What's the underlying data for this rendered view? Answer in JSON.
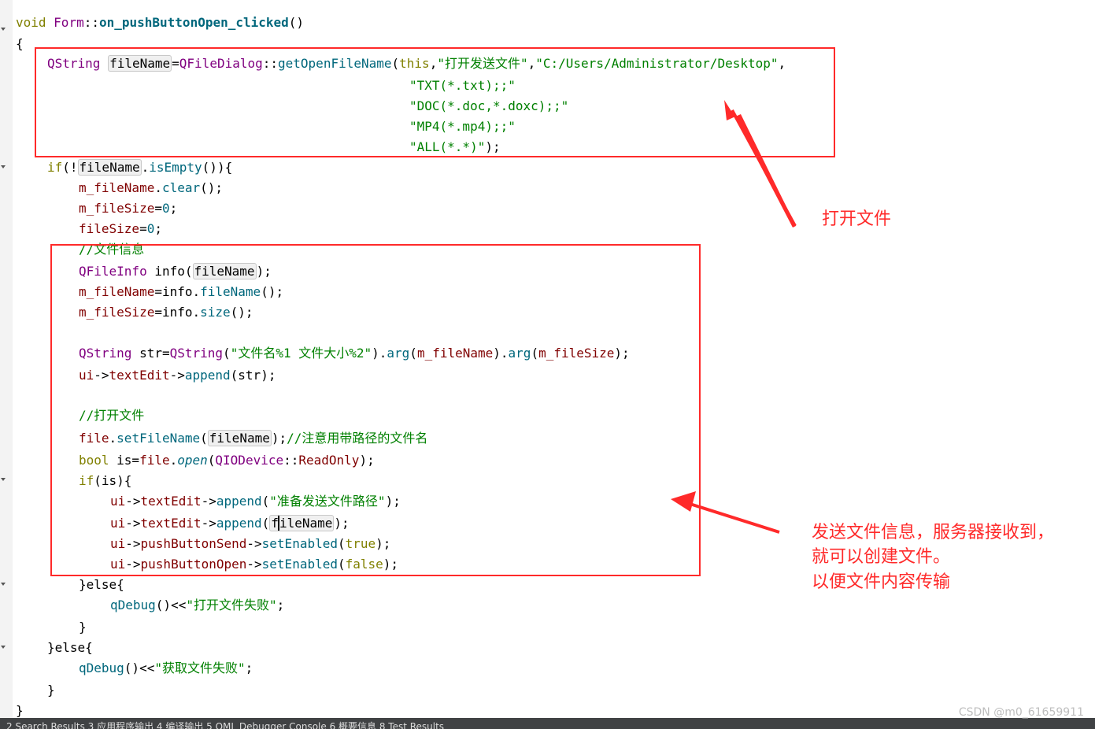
{
  "editor": {
    "language": "C++",
    "code": {
      "l1": {
        "a": "void",
        "b": "Form",
        "c": "::",
        "d": "on_pushButtonOpen_clicked",
        "e": "()"
      },
      "l2": {
        "a": "{"
      },
      "l3": {
        "a": "QString",
        "b": "fileName",
        "c": "=",
        "d": "QFileDialog",
        "e": "::",
        "f": "getOpenFileName",
        "g": "(",
        "h": "this",
        "i": ",",
        "j": "\"打开发送文件\"",
        "k": ",",
        "l": "\"C:/Users/Administrator/Desktop\"",
        "m": ","
      },
      "l4": {
        "a": "\"TXT(*.txt);;\""
      },
      "l5": {
        "a": "\"DOC(*.doc,*.doxc);;\""
      },
      "l6": {
        "a": "\"MP4(*.mp4);;\""
      },
      "l7": {
        "a": "\"ALL(*.*)\"",
        "b": ");"
      },
      "l8": {
        "a": "if",
        "b": "(!",
        "c": "fileName",
        "d": ".",
        "e": "isEmpty",
        "f": "()){"
      },
      "l9": {
        "a": "m_fileName",
        "b": ".",
        "c": "clear",
        "d": "();"
      },
      "l10": {
        "a": "m_fileSize",
        "b": "=",
        "c": "0",
        ";": ";"
      },
      "l11": {
        "a": "fileSize",
        "b": "=",
        "c": "0",
        "d": ";"
      },
      "l12": {
        "a": "//文件信息"
      },
      "l13": {
        "a": "QFileInfo",
        "b": " info(",
        "c": "fileName",
        "d": ");"
      },
      "l14": {
        "a": "m_fileName",
        "b": "=info.",
        "c": "fileName",
        "d": "();"
      },
      "l15": {
        "a": "m_fileSize",
        "b": "=info.",
        "c": "size",
        "d": "();"
      },
      "l17": {
        "a": "QString",
        "b": " str=",
        "c": "QString",
        "d": "(",
        "e": "\"文件名%1 文件大小%2\"",
        "f": ").",
        "g": "arg",
        "h": "(",
        "i": "m_fileName",
        "j": ").",
        "k": "arg",
        "l": "(",
        "m": "m_fileSize",
        "n": ");"
      },
      "l18": {
        "a": "ui",
        "b": "->",
        "c": "textEdit",
        "d": "->",
        "e": "append",
        "f": "(str);"
      },
      "l20": {
        "a": "//打开文件"
      },
      "l21": {
        "a": "file",
        "b": ".",
        "c": "setFileName",
        "d": "(",
        "e": "fileName",
        "f": ");",
        "g": "//注意用带路径的文件名"
      },
      "l22": {
        "a": "bool",
        "b": " is=",
        "c": "file",
        "d": ".",
        "e": "open",
        "f": "(",
        "g": "QIODevice",
        "h": "::",
        "i": "ReadOnly",
        "j": ");"
      },
      "l23": {
        "a": "if",
        "b": "(is){"
      },
      "l24": {
        "a": "ui",
        "b": "->",
        "c": "textEdit",
        "d": "->",
        "e": "append",
        "f": "(",
        "g": "\"准备发送文件路径\"",
        "h": ");"
      },
      "l25": {
        "a": "ui",
        "b": "->",
        "c": "textEdit",
        "d": "->",
        "e": "append",
        "f": "(",
        "g1": "f",
        "g2": "ileName",
        "h": ");"
      },
      "l26": {
        "a": "ui",
        "b": "->",
        "c": "pushButtonSend",
        "d": "->",
        "e": "setEnabled",
        "f": "(",
        "g": "true",
        "h": ");"
      },
      "l27": {
        "a": "ui",
        "b": "->",
        "c": "pushButtonOpen",
        "d": "->",
        "e": "setEnabled",
        "f": "(",
        "g": "false",
        "h": ");"
      },
      "l28": {
        "a": "}else{"
      },
      "l29": {
        "a": "qDebug",
        "b": "()<<",
        "c": "\"打开文件失败\"",
        "d": ";"
      },
      "l30": {
        "a": "}"
      },
      "l31": {
        "a": "}else{"
      },
      "l32": {
        "a": "qDebug",
        "b": "()<<",
        "c": "\"获取文件失败\"",
        "d": ";"
      },
      "l33": {
        "a": "}"
      },
      "l34": {
        "a": "}"
      }
    }
  },
  "annotations": {
    "open_file": "打开文件",
    "send_info_1": "发送文件信息，服务器接收到，",
    "send_info_2": "就可以创建文件。",
    "send_info_3": "以便文件内容传输"
  },
  "colors": {
    "annotation_red": "#ff2a2a",
    "keyword": "#808000",
    "type": "#800080",
    "function": "#00677c",
    "string": "#008000",
    "member": "#800000"
  },
  "status_bar": {
    "text": "2 Search Results   3 应用程序输出   4 编译输出   5 QML Debugger Console   6 概要信息   8 Test Results"
  },
  "watermark": "CSDN @m0_61659911"
}
